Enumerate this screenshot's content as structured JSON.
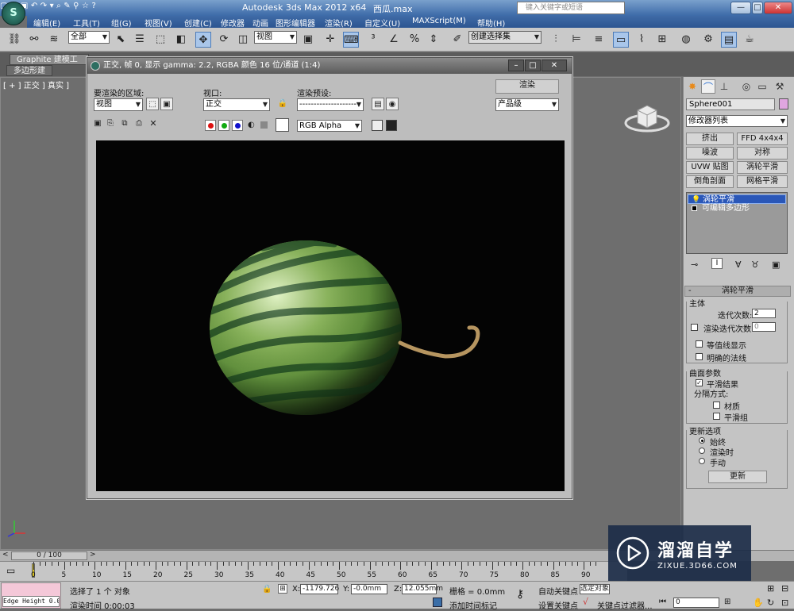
{
  "app": {
    "title": "Autodesk 3ds Max  2012 x64",
    "file": "西瓜.max",
    "logo": "S",
    "search_placeholder": "键入关键字或短语"
  },
  "menu": [
    "编辑(E)",
    "工具(T)",
    "组(G)",
    "视图(V)",
    "创建(C)",
    "修改器",
    "动画",
    "图形编辑器",
    "渲染(R)",
    "自定义(U)",
    "MAXScript(M)",
    "帮助(H)"
  ],
  "toolbar": {
    "selection_filter": "全部",
    "ref_coord": "视图",
    "named_selection": "创建选择集"
  },
  "ribbon": {
    "tab": "Graphite 建模工具",
    "subtab": "多边形建模"
  },
  "viewport": {
    "label": "[ + ] 正交 ] 真实 ]"
  },
  "render_window": {
    "title": "正交, 帧 0, 显示 gamma: 2.2, RGBA 颜色 16 位/通道 (1:4)",
    "area_label": "要渲染的区域:",
    "area_value": "视图",
    "viewport_label": "视口:",
    "viewport_value": "正交",
    "preset_label": "渲染预设:",
    "preset_value": "--------------------",
    "render_button": "渲染",
    "quality_value": "产品级",
    "channel_value": "RGB Alpha"
  },
  "command_panel": {
    "object_name": "Sphere001",
    "object_color": "#e0a6e0",
    "modifier_list": "修改器列表",
    "buttons": [
      "挤出",
      "FFD 4x4x4",
      "噪波",
      "对称",
      "UVW 贴图",
      "涡轮平滑",
      "倒角剖面",
      "网格平滑"
    ],
    "stack": [
      "涡轮平滑",
      "可编辑多边形"
    ],
    "rollout_title": "涡轮平滑",
    "main_group": "主体",
    "iterations_label": "迭代次数:",
    "iterations_value": "2",
    "render_iters_label": "渲染迭代次数:",
    "render_iters_value": "0",
    "isoline_label": "等值线显示",
    "explicit_normals_label": "明确的法线",
    "surface_group": "曲面参数",
    "smooth_result_label": "平滑结果",
    "separate_by_label": "分隔方式:",
    "materials_label": "材质",
    "smoothing_groups_label": "平滑组",
    "update_group": "更新选项",
    "update_always": "始终",
    "update_render": "渲染时",
    "update_manual": "手动",
    "update_button": "更新"
  },
  "timeline": {
    "frame": "0 / 100",
    "ticks": [
      "0",
      "5",
      "10",
      "15",
      "20",
      "25",
      "30",
      "35",
      "40",
      "45",
      "50",
      "55",
      "60",
      "65",
      "70",
      "75",
      "80",
      "85",
      "90"
    ]
  },
  "status": {
    "script": "Edge Height 0.0",
    "selected": "选择了 1 个 对象",
    "render_time": "渲染时间  0:00:03",
    "x_label": "X:",
    "x_value": "-1179.726",
    "y_label": "Y:",
    "y_value": "-0.0mm",
    "z_label": "Z:",
    "z_value": "12.055mm",
    "grid": "栅格 = 0.0mm",
    "add_tag": "添加时间标记",
    "auto_key": "自动关键点",
    "selected_obj": "选定对象",
    "set_key": "设置关键点",
    "key_filter": "关键点过滤器...",
    "frame_value": "0"
  },
  "watermark": {
    "title": "溜溜自学",
    "url": "ZIXUE.3D66.COM"
  }
}
